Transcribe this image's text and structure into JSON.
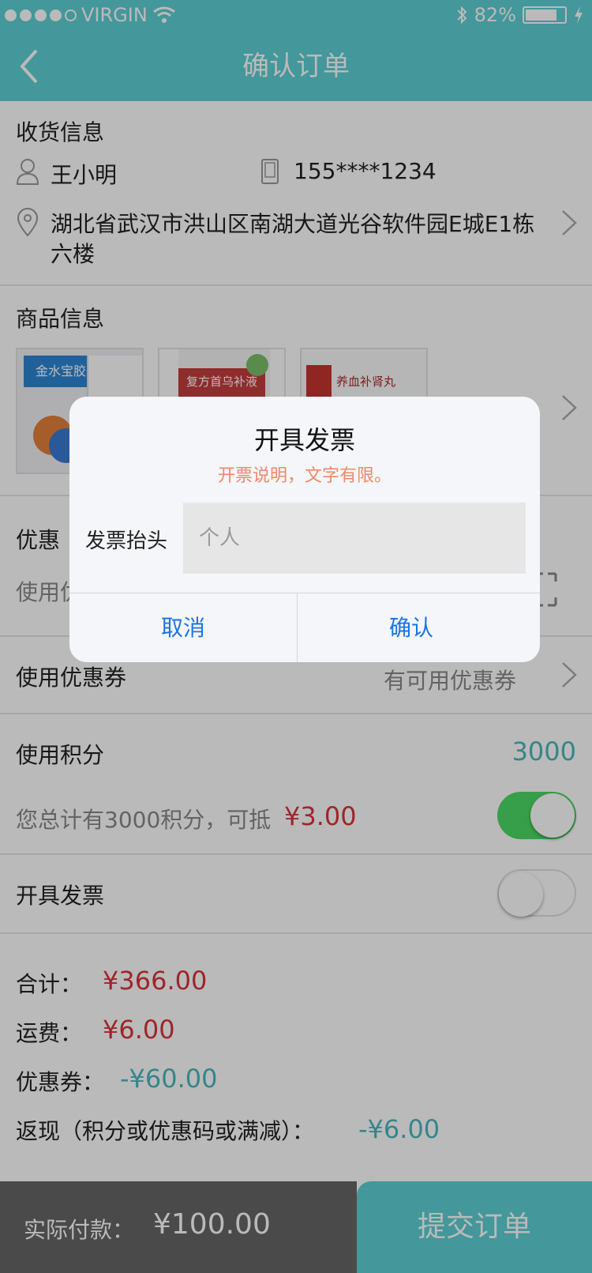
{
  "status_bar": {
    "carrier": "VIRGIN",
    "battery": "82%",
    "battery_level": 0.82
  },
  "nav": {
    "title": "确认订单"
  },
  "shipping": {
    "title": "收货信息",
    "name": "王小明",
    "phone": "155****1234",
    "address": "湖北省武汉市洪山区南湖大道光谷软件园E城E1栋",
    "address_line2": "六楼"
  },
  "products": {
    "title": "商品信息",
    "items": [
      {
        "label": "金水宝胶囊"
      },
      {
        "label": "复方首乌补液"
      },
      {
        "label": "养血补肾丸"
      }
    ]
  },
  "promo": {
    "title_partial": "优惠",
    "hint_partial": "使用优"
  },
  "coupon": {
    "label": "使用优惠券",
    "status": "有可用优惠券"
  },
  "points": {
    "label": "使用积分",
    "value": "3000",
    "desc": "您总计有3000积分，可抵",
    "deduct": "¥3.00",
    "enabled": true
  },
  "invoice": {
    "label": "开具发票",
    "enabled": false
  },
  "summary": {
    "total_label": "合计：",
    "total": "¥366.00",
    "freight_label": "运费：",
    "freight": "¥6.00",
    "coupon_label": "优惠券：",
    "coupon": "-¥60.00",
    "cashback_label": "返现（积分或优惠码或满减）：",
    "cashback": "-¥6.00"
  },
  "footer": {
    "pay_label": "实际付款：",
    "pay_amount": "¥100.00",
    "submit": "提交订单"
  },
  "dialog": {
    "title": "开具发票",
    "subtitle": "开票说明，文字有限。",
    "field_label": "发票抬头",
    "placeholder": "个人",
    "cancel": "取消",
    "confirm": "确认"
  },
  "colors": {
    "accent": "#5ecfd3",
    "price": "#d9343b",
    "discount": "#4ab7bd",
    "toggle_on": "#4cd964"
  }
}
